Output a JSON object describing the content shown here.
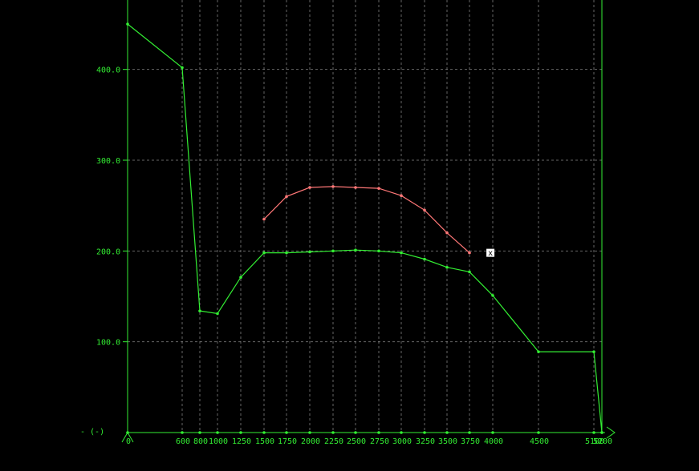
{
  "chart_data": {
    "type": "line",
    "ylabel": "- (-)",
    "xlabel": "",
    "xlim": [
      0,
      5200
    ],
    "ylim": [
      0,
      450
    ],
    "grid": true,
    "x_ticks": [
      0,
      600,
      800,
      1000,
      1250,
      1500,
      1750,
      2000,
      2250,
      2500,
      2750,
      3000,
      3250,
      3500,
      3750,
      4000,
      4500,
      5100,
      5200
    ],
    "x_tick_labels": [
      "0",
      "600",
      "800",
      "1000",
      "1250",
      "1500",
      "1750",
      "2000",
      "2250",
      "2500",
      "2750",
      "3000",
      "3250",
      "3500",
      "3750",
      "4000",
      "4500",
      "5100",
      "5200"
    ],
    "y_ticks": [
      100,
      200,
      300,
      400
    ],
    "y_tick_labels": [
      "100.0",
      "200.0",
      "300.0",
      "400.0"
    ],
    "series": [
      {
        "color": "#ff7777",
        "x": [
          1500,
          1750,
          2000,
          2250,
          2500,
          2750,
          3000,
          3250,
          3500,
          3750
        ],
        "y": [
          235,
          260,
          270,
          271,
          270,
          269,
          261,
          245,
          220,
          198
        ]
      },
      {
        "color": "#33ee33",
        "x": [
          0,
          600,
          800,
          1000,
          1250,
          1500,
          1750,
          2000,
          2250,
          2500,
          2750,
          3000,
          3250,
          3500,
          3750,
          4000,
          4500,
          5100,
          5200
        ],
        "y": [
          450,
          402,
          134,
          131,
          171,
          198,
          198,
          199,
          200,
          201,
          200,
          198,
          191,
          182,
          177,
          151,
          89,
          89,
          0
        ]
      }
    ],
    "cursor_point": {
      "x": 3975,
      "y": 198,
      "mark": "x"
    },
    "colors": {
      "background": "#000000",
      "axis": "#33ee33",
      "grid": "#888888",
      "marker_box": "#ffffff"
    }
  }
}
